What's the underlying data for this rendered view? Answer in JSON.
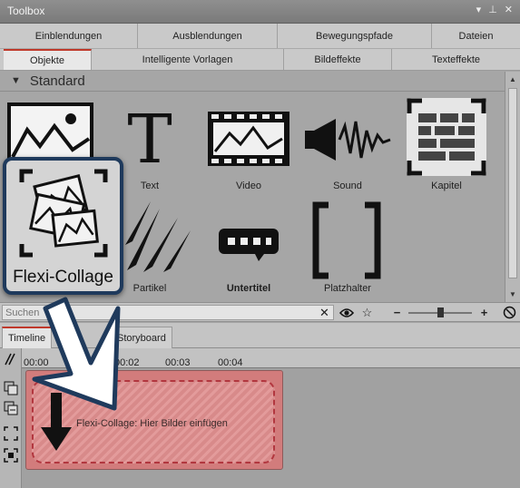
{
  "window": {
    "title": "Toolbox"
  },
  "tabs_row1": [
    {
      "label": "Einblendungen"
    },
    {
      "label": "Ausblendungen"
    },
    {
      "label": "Bewegungspfade"
    },
    {
      "label": "Dateien"
    }
  ],
  "tabs_row2": [
    {
      "label": "Objekte"
    },
    {
      "label": "Intelligente Vorlagen"
    },
    {
      "label": "Bildeffekte"
    },
    {
      "label": "Texteffekte"
    }
  ],
  "section": {
    "title": "Standard"
  },
  "items": {
    "text": "Text",
    "video": "Video",
    "sound": "Sound",
    "kapitel": "Kapitel",
    "partikel": "Partikel",
    "untertitel": "Untertitel",
    "platzhalter": "Platzhalter"
  },
  "callout": {
    "label": "Flexi-Collage"
  },
  "search": {
    "placeholder": "Suchen"
  },
  "timeline": {
    "tabs": [
      {
        "label": "Timeline"
      },
      {
        "label": "Storyboard"
      }
    ],
    "ruler": [
      "00:00",
      "00:02",
      "00:03",
      "00:04"
    ],
    "clip_label": "Flexi-Collage: Hier Bilder einfügen"
  },
  "colors": {
    "accent": "#c0392b",
    "callout_border": "#1f3a5c",
    "clip": "#d27c7c"
  }
}
